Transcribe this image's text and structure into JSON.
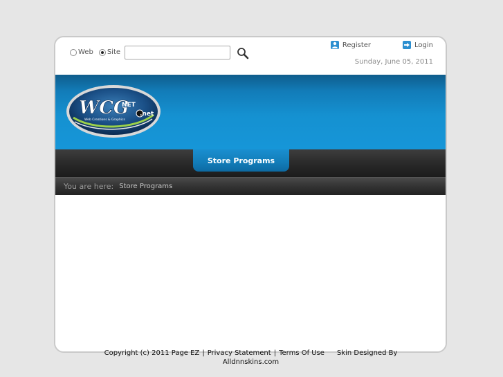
{
  "search": {
    "options": [
      {
        "label": "Web",
        "checked": false
      },
      {
        "label": "Site",
        "checked": true
      }
    ],
    "input_value": "",
    "button_icon": "magnifier-icon"
  },
  "user_links": {
    "register_label": "Register",
    "login_label": "Login"
  },
  "date": "Sunday, June 05, 2011",
  "logo": {
    "main_text": "WCG",
    "sup_text": "NET",
    "sub_text": "Web Creations & Graphics",
    "dot_text": ".net"
  },
  "nav": {
    "active_tab": "Store Programs"
  },
  "breadcrumb": {
    "prefix": "You are here:",
    "current": "Store Programs"
  },
  "footer": {
    "copyright": "Copyright (c) 2011 Page EZ",
    "privacy": "Privacy Statement",
    "terms": "Terms Of Use",
    "skin_credit": "Skin Designed By",
    "skin_site": "Alldnnskins.com"
  },
  "colors": {
    "background": "#e6e6e6",
    "banner_blue": "#1591d1",
    "nav_dark": "#2a2a2a",
    "tab_blue": "#127cb8"
  }
}
